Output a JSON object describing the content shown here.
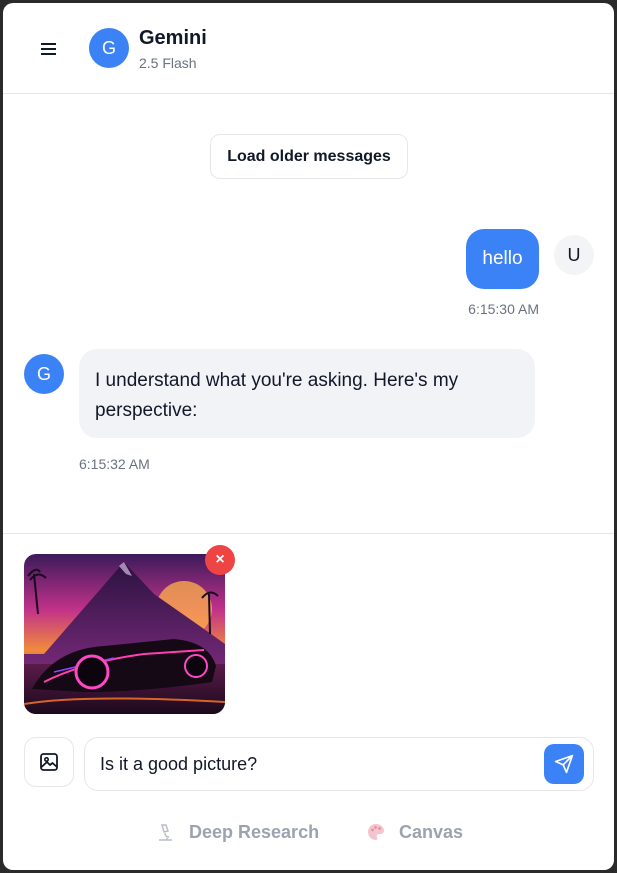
{
  "header": {
    "menu_icon": "hamburger-icon",
    "avatar_letter": "G",
    "title": "Gemini",
    "subtitle": "2.5 Flash"
  },
  "messages": {
    "load_older_label": "Load older messages",
    "items": [
      {
        "role": "user",
        "text": "hello",
        "avatar_letter": "U",
        "time": "6:15:30 AM"
      },
      {
        "role": "assistant",
        "text": "I understand what you're asking. Here's my perspective:",
        "avatar_letter": "G",
        "time": "6:15:32 AM"
      }
    ]
  },
  "composer": {
    "attachment": {
      "remove_label": "×",
      "icon": "image-thumbnail"
    },
    "image_button_icon": "image-icon",
    "input_value": "Is it a good picture?",
    "send_icon": "send-icon",
    "tools": [
      {
        "label": "Deep Research",
        "icon": "microscope-icon"
      },
      {
        "label": "Canvas",
        "icon": "palette-icon"
      }
    ]
  },
  "colors": {
    "accent": "#3b82f6",
    "remove": "#ef4444",
    "assistant_bubble": "#f1f3f7"
  }
}
